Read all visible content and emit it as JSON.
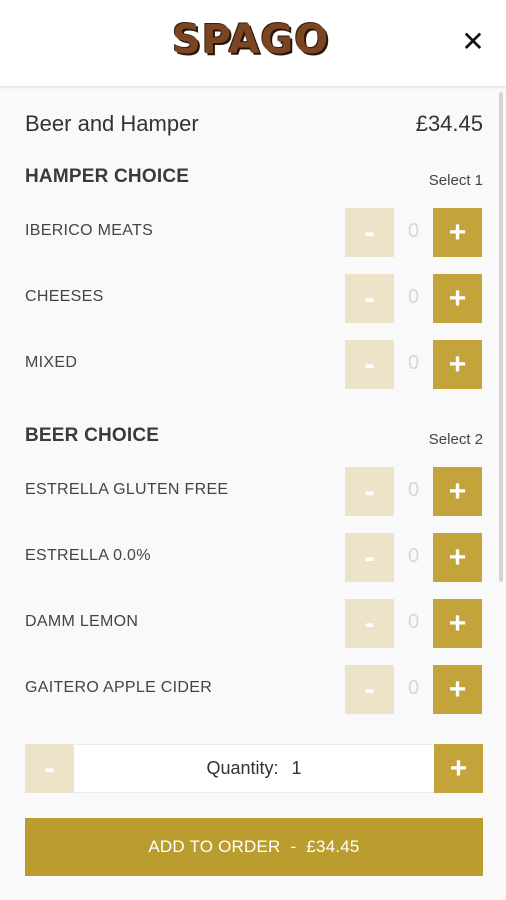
{
  "header": {
    "logo_text": "SPAGO",
    "close_glyph": "✕"
  },
  "item": {
    "title": "Beer and Hamper",
    "price": "£34.45"
  },
  "sections": [
    {
      "title": "HAMPER CHOICE",
      "subtitle": "Select 1",
      "options": [
        {
          "label": "IBERICO MEATS",
          "count": "0",
          "minus": "-",
          "plus": "+"
        },
        {
          "label": "CHEESES",
          "count": "0",
          "minus": "-",
          "plus": "+"
        },
        {
          "label": "MIXED",
          "count": "0",
          "minus": "-",
          "plus": "+"
        }
      ]
    },
    {
      "title": "BEER CHOICE",
      "subtitle": "Select 2",
      "options": [
        {
          "label": "ESTRELLA GLUTEN FREE",
          "count": "0",
          "minus": "-",
          "plus": "+"
        },
        {
          "label": "ESTRELLA 0.0%",
          "count": "0",
          "minus": "-",
          "plus": "+"
        },
        {
          "label": "DAMM LEMON",
          "count": "0",
          "minus": "-",
          "plus": "+"
        },
        {
          "label": "GAITERO APPLE CIDER",
          "count": "0",
          "minus": "-",
          "plus": "+"
        }
      ]
    }
  ],
  "quantity": {
    "label": "Quantity:",
    "value": "1",
    "minus": "-",
    "plus": "+"
  },
  "add_button": {
    "label": "ADD TO ORDER",
    "separator": "-",
    "price": "£34.45"
  },
  "colors": {
    "accent": "#c2a43a",
    "accent_disabled": "#ede3c9",
    "add_button": "#ba9c2f",
    "logo": "#7a4522"
  }
}
